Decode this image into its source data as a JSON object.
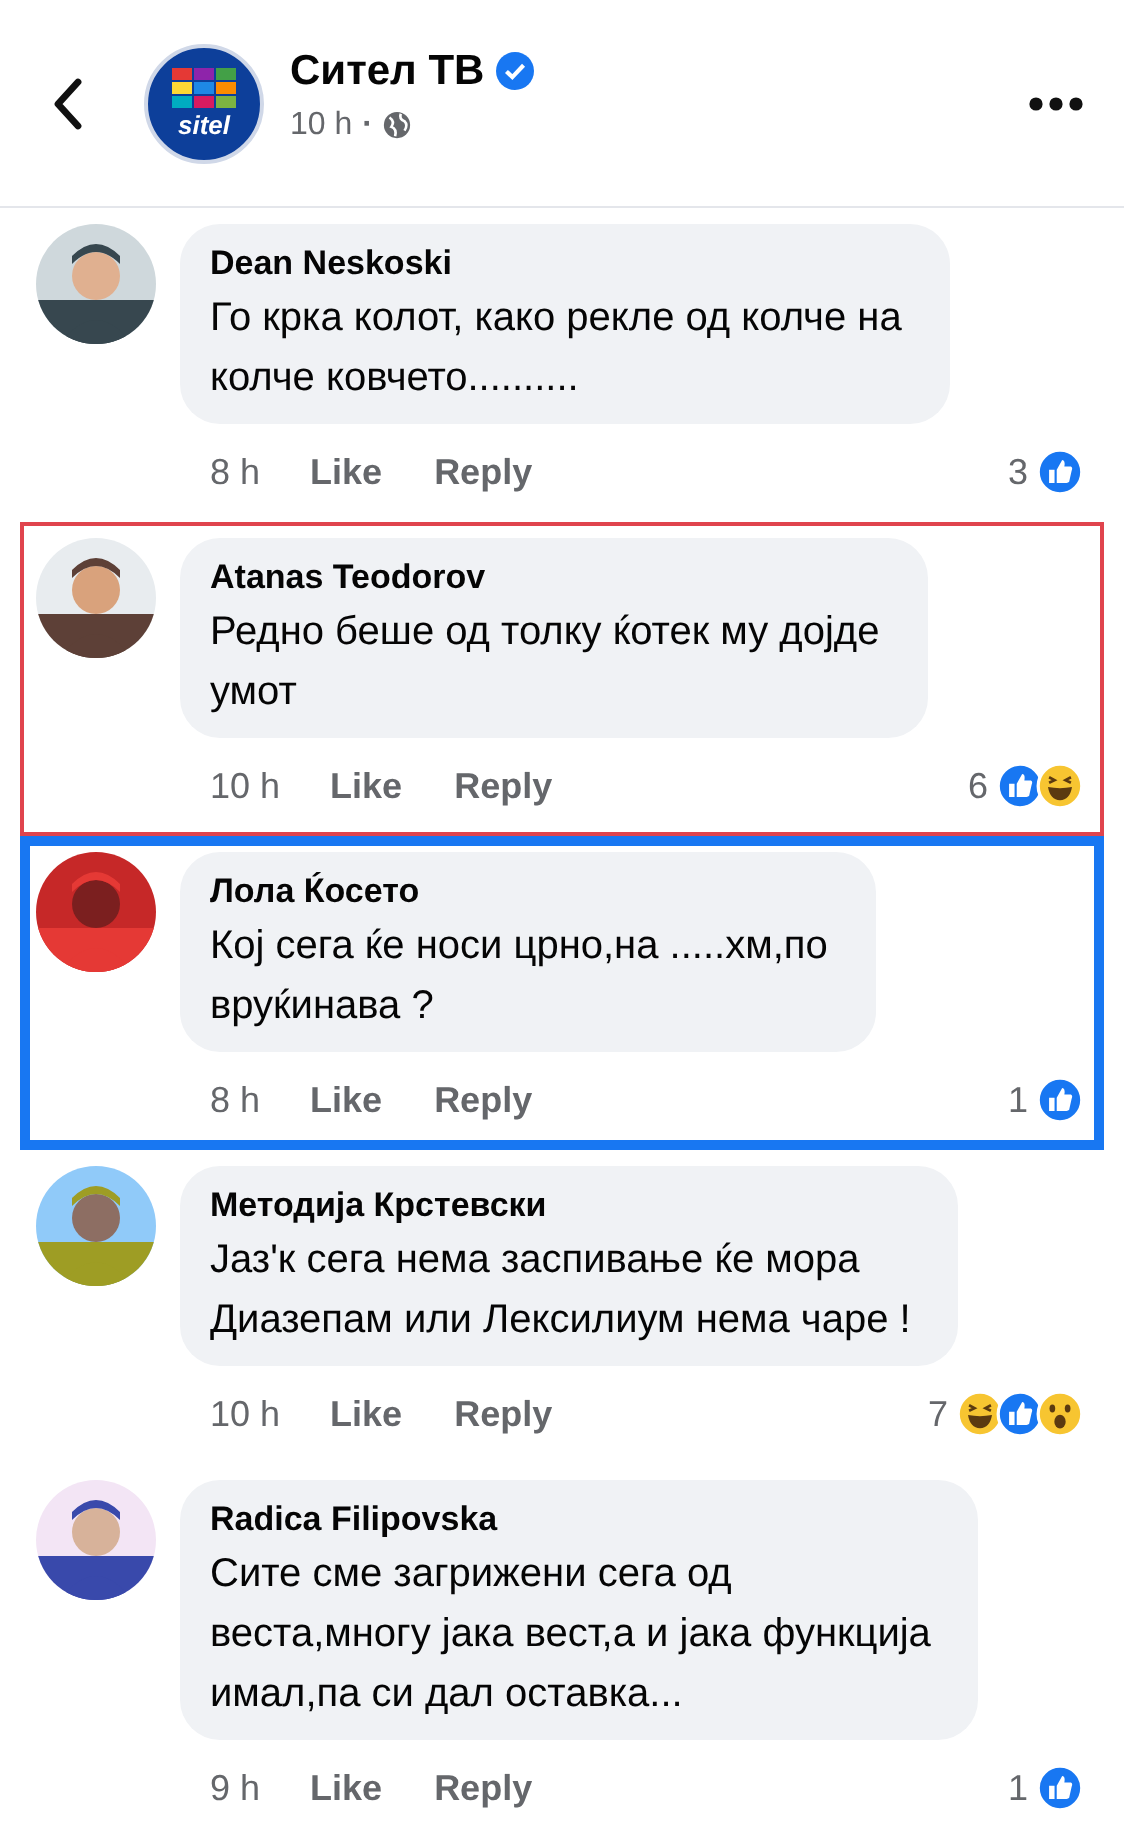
{
  "header": {
    "page_name": "Сител ТВ",
    "verified": true,
    "logo_text": "sitel",
    "time": "10 h",
    "separator": "·"
  },
  "comments": [
    {
      "author": "Dean Neskoski",
      "text": "Го крка колот, како рекле од колче на\nколче ковчето..........",
      "time": "8 h",
      "like": "Like",
      "reply": "Reply",
      "count": "3",
      "reactions": [
        {
          "kind": "like"
        }
      ]
    },
    {
      "author": "Atanas Teodorov",
      "text": "Редно беше од толку ќотек му дојде\nумот",
      "time": "10 h",
      "like": "Like",
      "reply": "Reply",
      "count": "6",
      "reactions": [
        {
          "kind": "like"
        },
        {
          "kind": "haha"
        }
      ],
      "highlight": {
        "kind": "thin",
        "color": "#e0444d"
      }
    },
    {
      "author": "Лола Ќосето",
      "text": "Кој сега ќе носи црно,на .....хм,по\nвруќинава ?",
      "time": "8 h",
      "like": "Like",
      "reply": "Reply",
      "count": "1",
      "reactions": [
        {
          "kind": "like"
        }
      ],
      "highlight": {
        "kind": "thick",
        "color": "#1877f2"
      }
    },
    {
      "author": "Методија Крстевски",
      "text": "Јаз'к сега нема заспивање ќе мора\nДиазепам или Лексилиум нема чаре !",
      "time": "10 h",
      "like": "Like",
      "reply": "Reply",
      "count": "7",
      "reactions": [
        {
          "kind": "haha"
        },
        {
          "kind": "like"
        },
        {
          "kind": "wow"
        }
      ]
    },
    {
      "author": "Radica Filipovska",
      "text": "Сите сме загрижени сега од\nвеста,многу јака вест,а и јака функција\nимал,па си дал оставка...",
      "time": "9 h",
      "like": "Like",
      "reply": "Reply",
      "count": "1",
      "reactions": [
        {
          "kind": "like"
        }
      ]
    }
  ]
}
